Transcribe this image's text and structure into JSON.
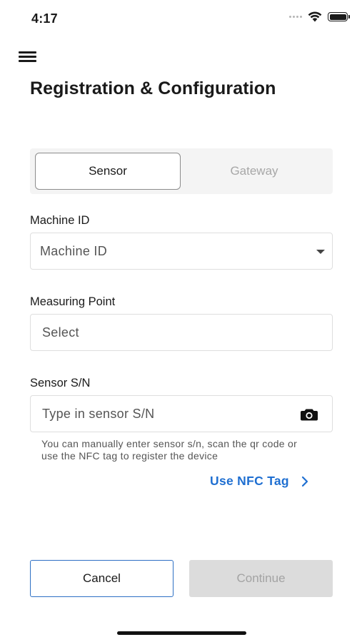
{
  "status_bar": {
    "time": "4:17"
  },
  "header": {
    "title": "Registration & Configuration",
    "menu_icon": "hamburger-menu-icon"
  },
  "segmented": {
    "tabs": [
      {
        "label": "Sensor",
        "selected": true
      },
      {
        "label": "Gateway",
        "selected": false
      }
    ]
  },
  "form": {
    "machine_id": {
      "label": "Machine ID",
      "placeholder": "Machine ID"
    },
    "measuring_point": {
      "label": "Measuring Point",
      "placeholder": "Select"
    },
    "sensor_sn": {
      "label": "Sensor S/N",
      "placeholder": "Type in sensor S/N",
      "helper": "You can manually enter sensor s/n, scan the qr code or use the NFC tag to register the device"
    },
    "nfc_link": "Use NFC Tag"
  },
  "actions": {
    "cancel": "Cancel",
    "continue": "Continue"
  },
  "colors": {
    "accent": "#1f6fd1",
    "cancel_border": "#2d6fc4",
    "disabled_bg": "#dcdcdc",
    "disabled_text": "#a3a3a3"
  }
}
